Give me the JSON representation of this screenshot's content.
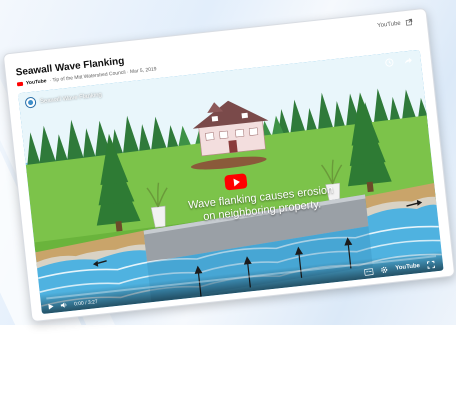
{
  "card": {
    "top_link_label": "YouTube",
    "title": "Seawall Wave Flanking",
    "meta_brand": "YouTube",
    "meta_info": "· Tip of the Mitt Watershed Council · Mar 5, 2019"
  },
  "player": {
    "title": "Seawall Wave Flanking",
    "caption_line1": "Wave flanking causes erosion",
    "caption_line2": "on neighboring property.",
    "time": "0:00 / 3:27",
    "brand": "YouTube",
    "progress": 0.0
  },
  "icons": {
    "external": "external-link-icon",
    "clock": "clock-icon",
    "share": "share-icon",
    "play": "play-icon",
    "volume": "volume-icon",
    "captions": "captions-icon",
    "settings": "gear-icon",
    "fullscreen": "fullscreen-icon"
  },
  "colors": {
    "brand_red": "#ff0000",
    "water": "#4fb2e0",
    "grass": "#7cc34a",
    "sky": "#e9f6fb"
  }
}
